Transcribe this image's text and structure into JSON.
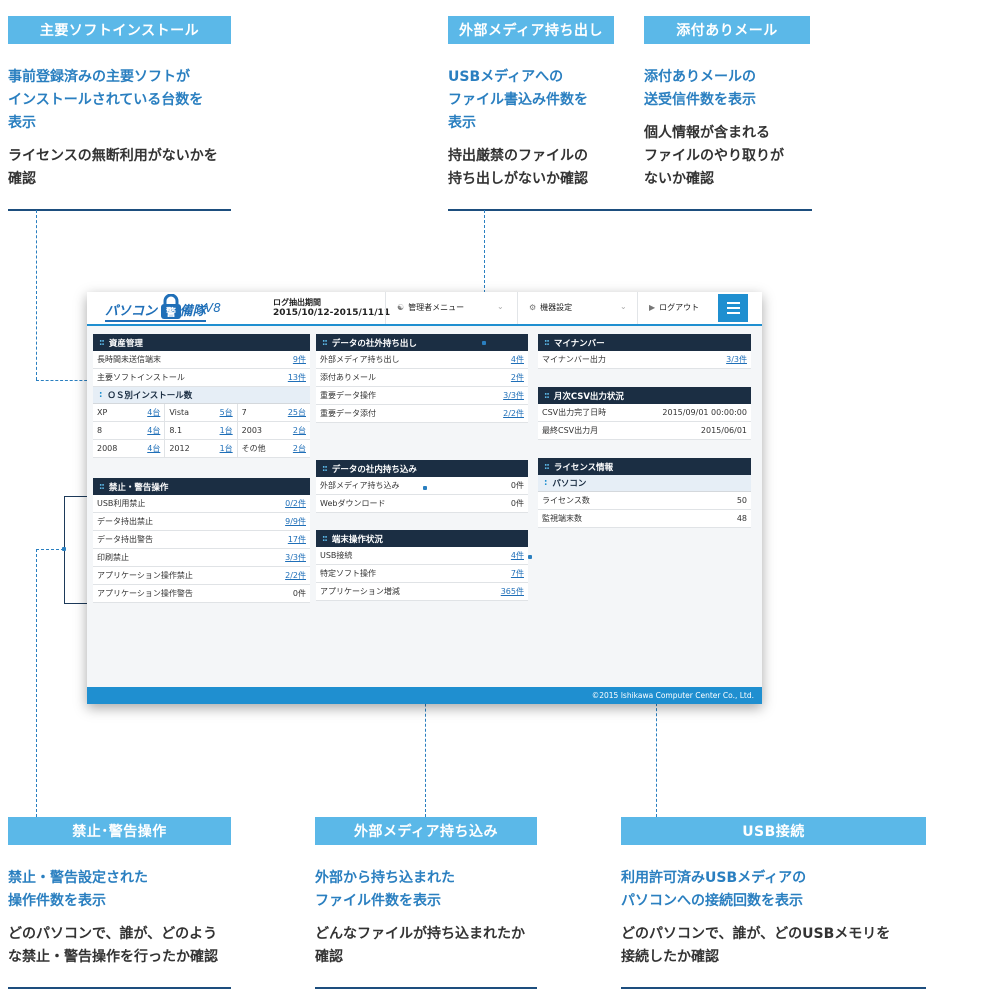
{
  "callouts": {
    "software": {
      "title": "主要ソフトインストール",
      "lead": "事前登録済みの主要ソフトが\nインストールされている台数を\n表示",
      "body": "ライセンスの無断利用がないかを\n確認"
    },
    "media_out": {
      "title": "外部メディア持ち出し",
      "lead": "USBメディアへの\nファイル書込み件数を\n表示",
      "body": "持出厳禁のファイルの\n持ち出しがないか確認"
    },
    "mail": {
      "title": "添付ありメール",
      "lead": "添付ありメールの\n送受信件数を表示",
      "body": "個人情報が含まれる\nファイルのやり取りが\nないか確認"
    },
    "prohibit": {
      "title": "禁止･警告操作",
      "lead": "禁止・警告設定された\n操作件数を表示",
      "body": "どのパソコンで、誰が、どのよう\nな禁止・警告操作を行ったか確認"
    },
    "media_in": {
      "title": "外部メディア持ち込み",
      "lead": "外部から持ち込まれた\nファイル件数を表示",
      "body": "どんなファイルが持ち込まれたか\n確認"
    },
    "usb": {
      "title": "USB接続",
      "lead": "利用許可済みUSBメディアの\nパソコンへの接続回数を表示",
      "body": "どのパソコンで、誰が、どのUSBメモリを\n接続したか確認"
    }
  },
  "app": {
    "logo_text": "パソコン",
    "logo_lock_char": "警",
    "logo_text2": "備隊",
    "logo_version": "V8",
    "period_label": "ログ抽出期間",
    "period_value": "2015/10/12-2015/11/11",
    "admin_menu": "管理者メニュー",
    "device_settings": "機器設定",
    "logout": "ログアウト",
    "footer": "©2015 Ishikawa Computer Center Co., Ltd.",
    "assets": {
      "title": "資産管理",
      "rows": [
        {
          "label": "長時間未送信端末",
          "value": "9件"
        },
        {
          "label": "主要ソフトインストール",
          "value": "13件"
        }
      ],
      "os_title": "ＯＳ別インストール数",
      "os": [
        {
          "label": "XP",
          "value": "4台"
        },
        {
          "label": "Vista",
          "value": "5台"
        },
        {
          "label": "7",
          "value": "25台"
        },
        {
          "label": "8",
          "value": "4台"
        },
        {
          "label": "8.1",
          "value": "1台"
        },
        {
          "label": "2003",
          "value": "2台"
        },
        {
          "label": "2008",
          "value": "4台"
        },
        {
          "label": "2012",
          "value": "1台"
        },
        {
          "label": "その他",
          "value": "2台"
        }
      ]
    },
    "prohibit": {
      "title": "禁止・警告操作",
      "rows": [
        {
          "label": "USB利用禁止",
          "value": "0/2件"
        },
        {
          "label": "データ持出禁止",
          "value": "9/9件"
        },
        {
          "label": "データ持出警告",
          "value": "17件"
        },
        {
          "label": "印刷禁止",
          "value": "3/3件"
        },
        {
          "label": "アプリケーション操作禁止",
          "value": "2/2件"
        },
        {
          "label": "アプリケーション操作警告",
          "value": "0件"
        }
      ]
    },
    "export": {
      "title": "データの社外持ち出し",
      "rows": [
        {
          "label": "外部メディア持ち出し",
          "value": "4件"
        },
        {
          "label": "添付ありメール",
          "value": "2件"
        },
        {
          "label": "重要データ操作",
          "value": "3/3件"
        },
        {
          "label": "重要データ添付",
          "value": "2/2件"
        }
      ]
    },
    "import": {
      "title": "データの社内持ち込み",
      "rows": [
        {
          "label": "外部メディア持ち込み",
          "value": "0件"
        },
        {
          "label": "Webダウンロード",
          "value": "0件"
        }
      ]
    },
    "terminal": {
      "title": "端末操作状況",
      "rows": [
        {
          "label": "USB接続",
          "value": "4件"
        },
        {
          "label": "特定ソフト操作",
          "value": "7件"
        },
        {
          "label": "アプリケーション増減",
          "value": "365件"
        }
      ]
    },
    "mynumber": {
      "title": "マイナンバー",
      "rows": [
        {
          "label": "マイナンバー出力",
          "value": "3/3件"
        }
      ]
    },
    "csv": {
      "title": "月次CSV出力状況",
      "rows": [
        {
          "label": "CSV出力完了日時",
          "value": "2015/09/01 00:00:00"
        },
        {
          "label": "最終CSV出力月",
          "value": "2015/06/01"
        }
      ]
    },
    "license": {
      "title": "ライセンス情報",
      "sub_title": "パソコン",
      "rows": [
        {
          "label": "ライセンス数",
          "value": "50"
        },
        {
          "label": "監視端末数",
          "value": "48"
        }
      ]
    }
  },
  "colors": {
    "callout_bar": "#5bb8e8",
    "lead_text": "#2a7fc0",
    "rule": "#1d4e7e",
    "panel_header": "#1b2e43",
    "accent": "#1f8fd0"
  }
}
